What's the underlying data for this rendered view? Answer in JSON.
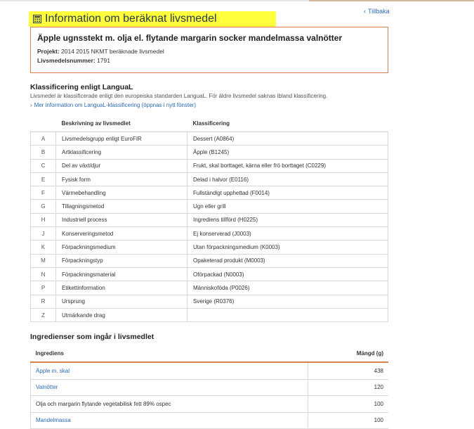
{
  "header": {
    "title": "Information om beräknat livsmedel",
    "back_label": "Tillbaka"
  },
  "food": {
    "name": "Äpple ugnsstekt m. olja el. flytande margarin socker mandelmassa valnötter",
    "project_label": "Projekt:",
    "project_value": "2014 2015 NKMT beräknade livsmedel",
    "number_label": "Livsmedelsnummer:",
    "number_value": "1791"
  },
  "langual": {
    "title": "Klassificering enligt LanguaL",
    "description": "Livsmedel är klassificerade enligt den europeiska standarden LanguaL. För äldre livsmedel saknas ibland klassificering.",
    "more_link": "Mer information om LanguaL-klassificering (öppnas i nytt fönster)",
    "col_description": "Beskrivning av livsmedlet",
    "col_classification": "Klassificering",
    "rows": [
      {
        "code": "A",
        "description": "Livsmedelsgrupp enligt EuroFIR",
        "classification": "Dessert (A0864)"
      },
      {
        "code": "B",
        "description": "Artklassificering",
        "classification": "Äpple (B1245)"
      },
      {
        "code": "C",
        "description": "Del av växt/djur",
        "classification": "Frukt, skal borttaget, kärna eller frö borttaget (C0229)"
      },
      {
        "code": "E",
        "description": "Fysisk form",
        "classification": "Delad i halvor (E0116)"
      },
      {
        "code": "F",
        "description": "Värmebehandling",
        "classification": "Fullständigt upphettad (F0014)"
      },
      {
        "code": "G",
        "description": "Tillagningsmetod",
        "classification": "Ugn eller grill"
      },
      {
        "code": "H",
        "description": "Industriell process",
        "classification": "Ingrediens tillförd (H0225)"
      },
      {
        "code": "J",
        "description": "Konserveringsmetod",
        "classification": "Ej konserverad (J0003)"
      },
      {
        "code": "K",
        "description": "Förpackningsmedium",
        "classification": "Utan förpackningsmedium (K0003)"
      },
      {
        "code": "M",
        "description": "Förpackningstyp",
        "classification": "Opaketerad produkt (M0003)"
      },
      {
        "code": "N",
        "description": "Förpackningsmaterial",
        "classification": "Oförpackad (N0003)"
      },
      {
        "code": "P",
        "description": "Etikettinformation",
        "classification": "Människoföda (P0026)"
      },
      {
        "code": "R",
        "description": "Ursprung",
        "classification": "Sverige (R0376)"
      },
      {
        "code": "Z",
        "description": "Utmärkande drag",
        "classification": ""
      }
    ]
  },
  "ingredients": {
    "title": "Ingredienser som ingår i livsmedlet",
    "col_ingredient": "Ingrediens",
    "col_amount": "Mängd (g)",
    "rows": [
      {
        "name": "Äpple m. skal",
        "amount": "438",
        "link": true
      },
      {
        "name": "Valnötter",
        "amount": "120",
        "link": true
      },
      {
        "name": "Olja och margarin flytande vegetabilisk fett 89% ospec",
        "amount": "100",
        "link": false
      },
      {
        "name": "Mandelmassa",
        "amount": "100",
        "link": true
      }
    ]
  },
  "colors": {
    "highlight": "#ffff3c",
    "accent_border": "#d9824e",
    "link": "#2a6ab2"
  }
}
